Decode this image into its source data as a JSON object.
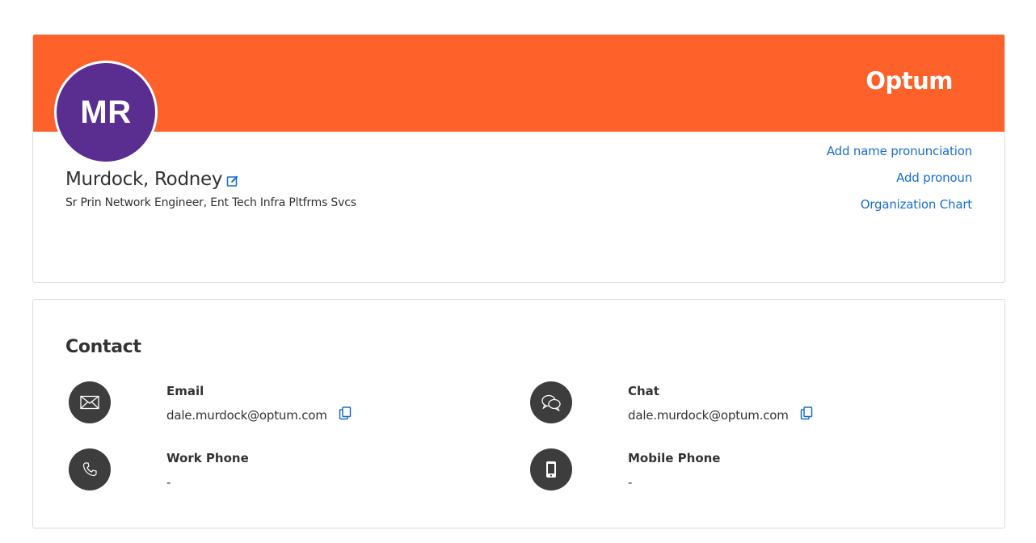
{
  "colors": {
    "banner": "#ff612b",
    "avatar_bg": "#5a2d91",
    "link": "#196ecf",
    "icon_bg": "#3d3d3d"
  },
  "profile": {
    "brand": "Optum",
    "initials": "MR",
    "name": "Murdock, Rodney",
    "job_title": "Sr Prin Network Engineer, Ent Tech Infra Pltfrms Svcs",
    "links": {
      "name_pronunciation": "Add name pronunciation",
      "pronoun": "Add pronoun",
      "org_chart": "Organization Chart"
    }
  },
  "contact": {
    "title": "Contact",
    "email": {
      "label": "Email",
      "value": "dale.murdock@optum.com",
      "icon": "envelope-icon"
    },
    "chat": {
      "label": "Chat",
      "value": "dale.murdock@optum.com",
      "icon": "chat-bubbles-icon"
    },
    "work_phone": {
      "label": "Work Phone",
      "value": "-",
      "icon": "phone-icon"
    },
    "mobile_phone": {
      "label": "Mobile Phone",
      "value": "-",
      "icon": "mobile-phone-icon"
    }
  }
}
